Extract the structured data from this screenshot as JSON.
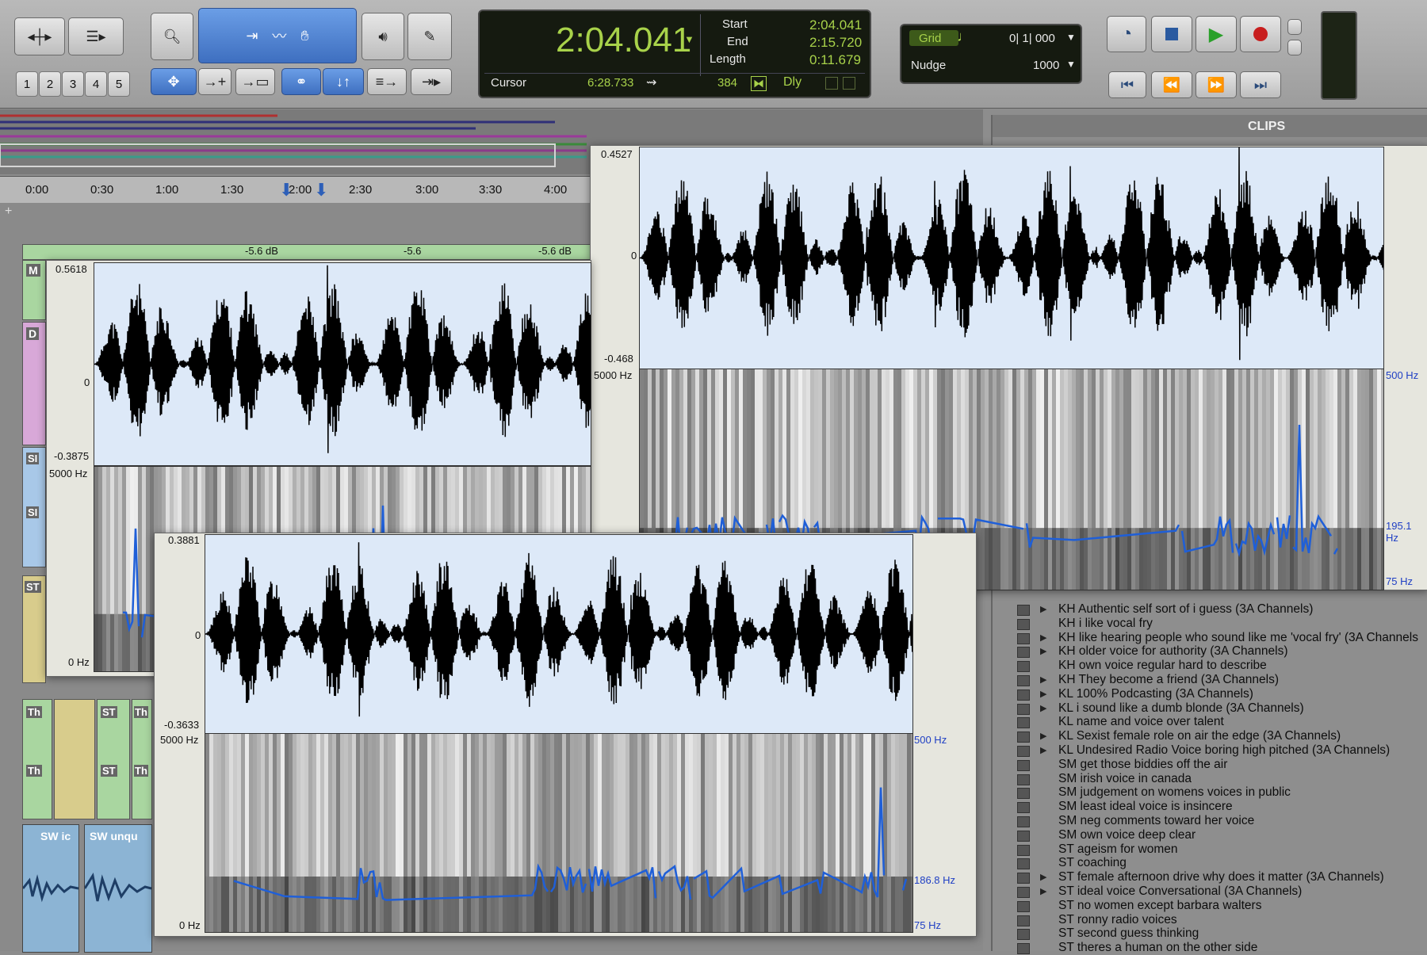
{
  "counter": {
    "main": "2:04.041",
    "start_label": "Start",
    "end_label": "End",
    "length_label": "Length",
    "start": "2:04.041",
    "end": "2:15.720",
    "length": "0:11.679",
    "cursor_label": "Cursor",
    "cursor": "6:28.733",
    "misc_num": "384",
    "dly_label": "Dly"
  },
  "grid": {
    "grid_label": "Grid",
    "grid_value": "0| 1| 000",
    "nudge_label": "Nudge",
    "nudge_value": "1000"
  },
  "zoom_presets": [
    "1",
    "2",
    "3",
    "4",
    "5"
  ],
  "ruler": {
    "ticks": [
      "0:00",
      "0:30",
      "1:00",
      "1:30",
      "2:00",
      "2:30",
      "3:00",
      "3:30",
      "4:00"
    ]
  },
  "tracks": {
    "gain_labels": [
      "-5.6 dB",
      "-5.6",
      "-5.6 dB"
    ],
    "track_badges": [
      "M",
      "D",
      "SI",
      "SI",
      "ST",
      "Th",
      "Th",
      "ST",
      "ST",
      "Th",
      "Th"
    ],
    "clip_names": [
      "SW ic",
      "SW unqu"
    ]
  },
  "clips_panel": {
    "title": "CLIPS",
    "items": [
      {
        "name": "KH Authentic self sort of i guess (3A Channels)",
        "expand": true
      },
      {
        "name": "KH i like vocal fry",
        "expand": false
      },
      {
        "name": "KH like hearing people who sound like me 'vocal fry' (3A Channels",
        "expand": true
      },
      {
        "name": "KH older voice for authority (3A Channels)",
        "expand": true
      },
      {
        "name": "KH own voice regular hard to describe",
        "expand": false
      },
      {
        "name": "KH They become a friend (3A Channels)",
        "expand": true
      },
      {
        "name": "KL 100% Podcasting (3A Channels)",
        "expand": true
      },
      {
        "name": "KL i sound like a dumb blonde (3A Channels)",
        "expand": true
      },
      {
        "name": "KL name and voice over talent",
        "expand": false
      },
      {
        "name": "KL Sexist female role on air the edge (3A Channels)",
        "expand": true
      },
      {
        "name": "KL Undesired Radio Voice boring high pitched (3A Channels)",
        "expand": true
      },
      {
        "name": "SM get those biddies off the air",
        "expand": false
      },
      {
        "name": "SM irish voice in canada",
        "expand": false
      },
      {
        "name": "SM judgement on womens voices in public",
        "expand": false
      },
      {
        "name": "SM least ideal voice is insincere",
        "expand": false
      },
      {
        "name": "SM neg comments toward her voice",
        "expand": false
      },
      {
        "name": "SM own voice deep clear",
        "expand": false
      },
      {
        "name": "ST ageism for women",
        "expand": false
      },
      {
        "name": "ST coaching",
        "expand": false
      },
      {
        "name": "ST female afternoon drive why does it matter (3A Channels)",
        "expand": true
      },
      {
        "name": "ST ideal voice Conversational (3A Channels)",
        "expand": true
      },
      {
        "name": "ST no women except barbara walters",
        "expand": false
      },
      {
        "name": "ST ronny radio voices",
        "expand": false
      },
      {
        "name": "ST second guess thinking",
        "expand": false
      },
      {
        "name": "ST theres a human on the other side",
        "expand": false
      }
    ]
  },
  "praat_windows": [
    {
      "wave_max": "0.5618",
      "wave_zero": "0",
      "wave_min": "-0.3875",
      "spec_max": "5000 Hz",
      "spec_min": "0 Hz"
    },
    {
      "wave_max": "0.4527",
      "wave_zero": "0",
      "wave_min": "-0.468",
      "spec_max": "5000 Hz",
      "pitch_max": "500 Hz",
      "pitch_mid": "195.1 Hz",
      "pitch_min": "75 Hz"
    },
    {
      "wave_max": "0.3881",
      "wave_zero": "0",
      "wave_min": "-0.3633",
      "spec_max": "5000 Hz",
      "spec_min": "0 Hz",
      "pitch_max": "500 Hz",
      "pitch_mid": "186.8 Hz",
      "pitch_min": "75 Hz"
    }
  ],
  "colors": {
    "lcd_green": "#a8d24a",
    "pitch_blue": "#1f5fd8",
    "wave_bg": "#dde9f8",
    "toolbar_blue": "#3e6fc0",
    "record_red": "#c81e1e",
    "play_green": "#2aa02a"
  }
}
